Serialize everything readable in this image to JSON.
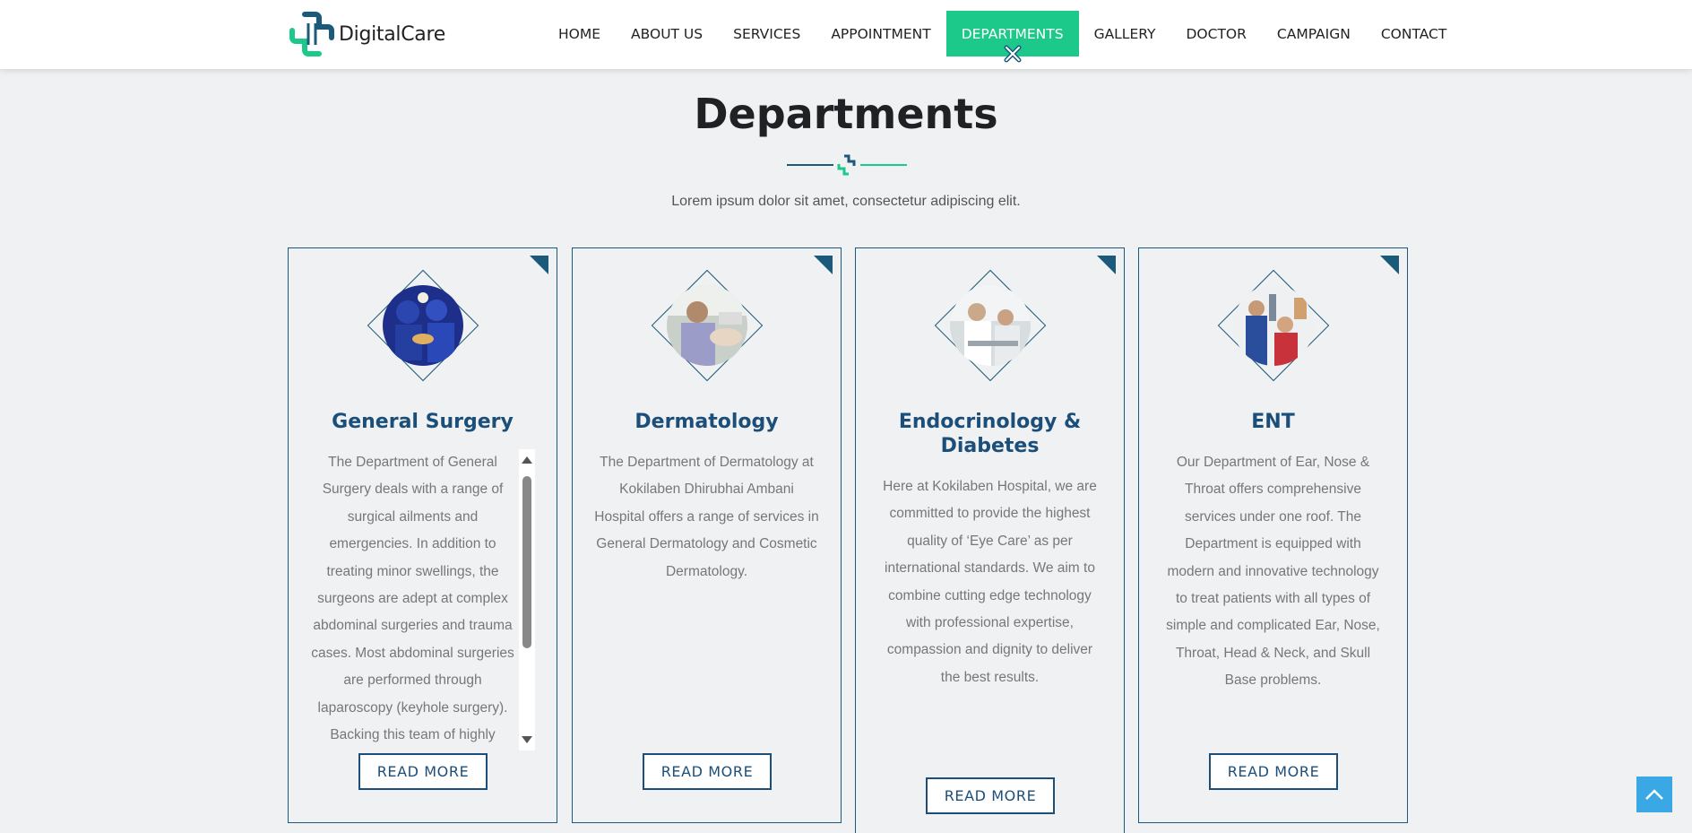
{
  "brand": {
    "name": "DigitalCare",
    "primary": "#1b5a7a",
    "accent": "#1cc98a"
  },
  "nav": {
    "items": [
      {
        "label": "HOME"
      },
      {
        "label": "ABOUT US"
      },
      {
        "label": "SERVICES"
      },
      {
        "label": "APPOINTMENT"
      },
      {
        "label": "DEPARTMENTS",
        "active": true
      },
      {
        "label": "GALLERY"
      },
      {
        "label": "DOCTOR"
      },
      {
        "label": "CAMPAIGN"
      },
      {
        "label": "CONTACT"
      }
    ]
  },
  "section": {
    "title": "Departments",
    "subtitle": "Lorem ipsum dolor sit amet, consectetur adipiscing elit."
  },
  "departments": [
    {
      "title": "General Surgery",
      "text": "The Department of General Surgery deals with a range of surgical ailments and emergencies. In addition to treating minor swellings, the surgeons are adept at complex abdominal surgeries and trauma cases. Most abdominal surgeries are performed through laparoscopy (keyhole surgery). Backing this team of highly",
      "button": "READ MORE",
      "image": "surgery-team-photo"
    },
    {
      "title": "Dermatology",
      "text": "The Department of Dermatology at Kokilaben Dhirubhai Ambani Hospital offers a range of services in General Dermatology and Cosmetic Dermatology.",
      "button": "READ MORE",
      "image": "dermatology-treatment-photo"
    },
    {
      "title": "Endocrinology & Diabetes",
      "text": "Here at Kokilaben Hospital, we are committed to provide the highest quality of ‘Eye Care’ as per international standards. We aim to combine cutting edge technology with professional expertise, compassion and dignity to deliver the best results.",
      "button": "READ MORE",
      "image": "doctor-consultation-photo"
    },
    {
      "title": "ENT",
      "text": "Our Department of Ear, Nose & Throat offers comprehensive services under one roof. The Department is equipped with modern and innovative technology to treat patients with all types of simple and complicated Ear, Nose, Throat, Head & Neck, and Skull Base problems.",
      "button": "READ MORE",
      "image": "ent-examination-photo"
    }
  ],
  "icons": {
    "logo": "medical-cross-logo-icon",
    "scroll_top": "chevron-up-icon",
    "card_corner": "corner-triangle-icon"
  }
}
